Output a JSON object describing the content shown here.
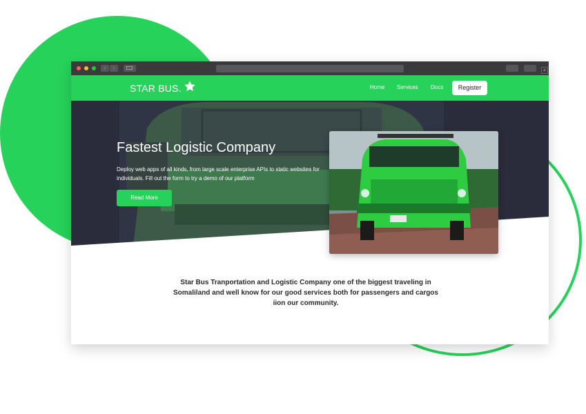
{
  "brand": {
    "name": "STAR BUS.",
    "icon": "star-icon"
  },
  "nav": {
    "items": [
      "Home",
      "Services",
      "Docs"
    ],
    "register_label": "Register"
  },
  "hero": {
    "headline": "Fastest Logistic Company",
    "subtext": "Deploy web apps of all kinds, from large scale enterprise APIs to static websites for individuals. Fill out the form to try a demo of our platform",
    "cta_label": "Read More"
  },
  "about": {
    "text": "Star Bus Tranportation and Logistic Company one of the biggest traveling in Somaliland and well know for our good services both for passengers and cargos iion our community."
  },
  "colors": {
    "accent": "#27d25a",
    "hero_overlay": "#2b2c3b",
    "chrome": "#3a3a3c"
  }
}
